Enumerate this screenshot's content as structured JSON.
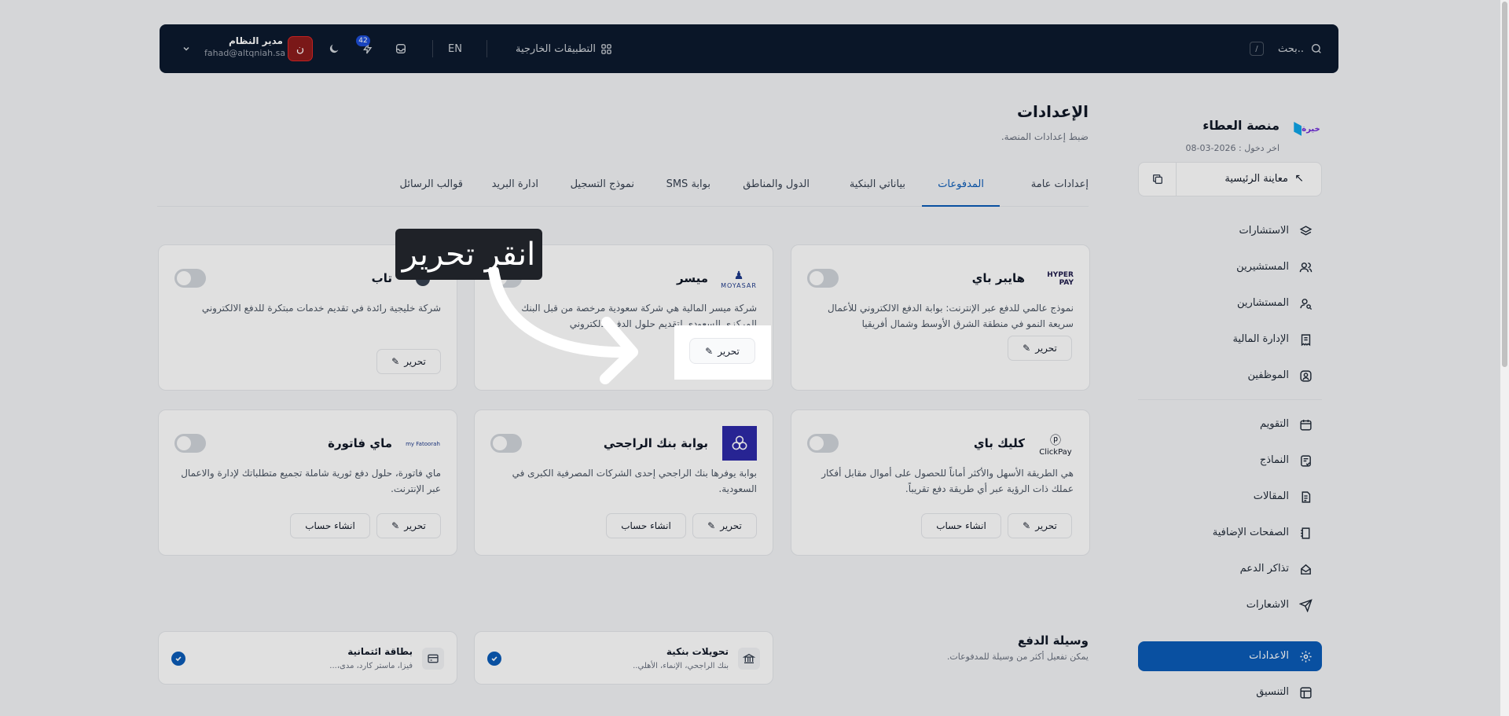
{
  "topbar": {
    "search_placeholder": "بحث..",
    "search_shortcut": "/",
    "external_apps": "التطبيقات الخارجية",
    "language": "EN",
    "notifications_count": "42",
    "user_name": "مدير النظام",
    "user_email": "fahad@altqniah.sa",
    "avatar_glyph": "ن"
  },
  "sidebar": {
    "brand_title": "منصة العطاء",
    "brand_logo_text": "خيرة",
    "brand_sub": "اخر دخول : 2026-03-08",
    "preview_label": "معاينة الرئيسية",
    "items": [
      {
        "label": "الاستشارات",
        "icon": "layers-icon"
      },
      {
        "label": "المستشيرين",
        "icon": "users-icon"
      },
      {
        "label": "المستشارين",
        "icon": "user-search-icon"
      },
      {
        "label": "الإدارة المالية",
        "icon": "receipt-icon"
      },
      {
        "label": "الموظفين",
        "icon": "user-square-icon"
      },
      {
        "label": "التقويم",
        "icon": "calendar-icon"
      },
      {
        "label": "النماذج",
        "icon": "form-icon"
      },
      {
        "label": "المقالات",
        "icon": "article-icon"
      },
      {
        "label": "الصفحات الإضافية",
        "icon": "page-icon"
      },
      {
        "label": "تذاكر الدعم",
        "icon": "ticket-icon"
      },
      {
        "label": "الاشعارات",
        "icon": "send-icon"
      },
      {
        "label": "الاعدادات",
        "icon": "gear-icon"
      },
      {
        "label": "التنسيق",
        "icon": "layout-icon"
      }
    ]
  },
  "page": {
    "title": "الإعدادات",
    "subtitle": "ضبط إعدادات المنصة."
  },
  "tabs": [
    {
      "label": "إعدادات عامة"
    },
    {
      "label": "المدفوعات"
    },
    {
      "label": "بياناتي البنكية"
    },
    {
      "label": "الدول والمناطق"
    },
    {
      "label": "بوابة SMS"
    },
    {
      "label": "نموذج التسجيل"
    },
    {
      "label": "ادارة البريد"
    },
    {
      "label": "قوالب الرسائل"
    }
  ],
  "cards": [
    {
      "name": "هايبر باي",
      "logo": "HYPER PAY",
      "desc": "نموذج عالمي للدفع عبر الإنترنت: بوابة الدفع الالكتروني للأعمال سريعة النمو في منطقة الشرق الأوسط وشمال أفريقيا",
      "edit": "تحرير",
      "create": ""
    },
    {
      "name": "ميسر",
      "logo": "MOYASAR",
      "desc": "شركة ميسر المالية هي شركة سعودية مرخصة من قبل البنك المركزي السعودي لتقديم حلول الدفع الالكتروني",
      "edit": "تحرير",
      "create": ""
    },
    {
      "name": "تاب",
      "logo": "",
      "desc": "شركة خليجية رائدة في تقديم خدمات مبتكرة للدفع الالكتروني",
      "edit": "تحرير",
      "create": ""
    },
    {
      "name": "كليك باي",
      "logo": "ClickPay",
      "desc": "هي الطريقة الأسهل والأكثر أماناً للحصول على أموال مقابل أفكار عملك ذات الرؤية عبر أي طريقة دفع تقريباً.",
      "edit": "تحرير",
      "create": "انشاء حساب"
    },
    {
      "name": "بوابة بنك الراجحي",
      "logo": "",
      "desc": "بوابة يوفرها بنك الراجحي إحدى الشركات المصرفية الكبرى في السعودية.",
      "edit": "تحرير",
      "create": "انشاء حساب"
    },
    {
      "name": "ماي فاتورة",
      "logo": "my Fatoorah",
      "desc": "ماي فاتورة، حلول دفع ثورية شاملة تجميع متطلباتك لإدارة والاعمال عبر الإنترنت.",
      "edit": "تحرير",
      "create": "انشاء حساب"
    }
  ],
  "payment_methods": {
    "title": "وسيلة الدفع",
    "subtitle": "يمكن تفعيل أكثر من وسيلة للمدفوعات.",
    "items": [
      {
        "title": "تحويلات بنكية",
        "sub": "بنك الراجحي، الإنماء، الأهلي.."
      },
      {
        "title": "بطاقة ائتمانية",
        "sub": "فيزا، ماستر كارد، مدى،..."
      }
    ]
  },
  "overlay": {
    "callout": "انقر تحرير",
    "highlight_label": "تحرير"
  }
}
